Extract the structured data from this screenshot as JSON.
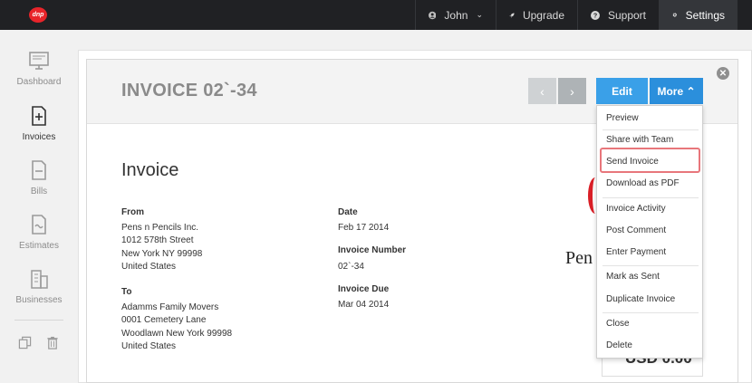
{
  "topbar": {
    "logo_text": "dnp",
    "user_name": "John",
    "upgrade_label": "Upgrade",
    "support_label": "Support",
    "settings_label": "Settings"
  },
  "sidebar": {
    "items": [
      {
        "label": "Dashboard",
        "icon": "monitor-icon"
      },
      {
        "label": "Invoices",
        "icon": "invoice-add-icon"
      },
      {
        "label": "Bills",
        "icon": "bill-icon"
      },
      {
        "label": "Estimates",
        "icon": "estimate-icon"
      },
      {
        "label": "Businesses",
        "icon": "building-icon"
      }
    ]
  },
  "invoice": {
    "title": "INVOICE 02`-34",
    "heading": "Invoice",
    "from_label": "From",
    "from_lines": [
      "Pens n Pencils Inc.",
      "1012 578th Street",
      "New York NY 99998",
      "United States"
    ],
    "to_label": "To",
    "to_lines": [
      "Adamms Family Movers",
      "0001 Cemetery Lane",
      "Woodlawn New York 99998",
      "United States"
    ],
    "date_label": "Date",
    "date_value": "Feb 17 2014",
    "number_label": "Invoice Number",
    "number_value": "02`-34",
    "due_label": "Invoice Due",
    "due_value": "Mar 04 2014",
    "brand_partial": "Pen",
    "total_partial": "USD 0.00"
  },
  "actions": {
    "prev_glyph": "‹",
    "next_glyph": "›",
    "edit_label": "Edit",
    "more_label": "More ⌃",
    "close_glyph": "✕"
  },
  "menu": {
    "items": [
      "Preview",
      "Share with Team",
      "Send Invoice",
      "Download as PDF",
      "Invoice Activity",
      "Post Comment",
      "Enter Payment",
      "Mark as Sent",
      "Duplicate Invoice",
      "Close",
      "Delete"
    ],
    "highlighted": "Send Invoice"
  },
  "colors": {
    "topbar": "#202124",
    "accent_blue": "#2b8fdc",
    "highlight": "#e8767b",
    "brand_red": "#d91e26"
  }
}
